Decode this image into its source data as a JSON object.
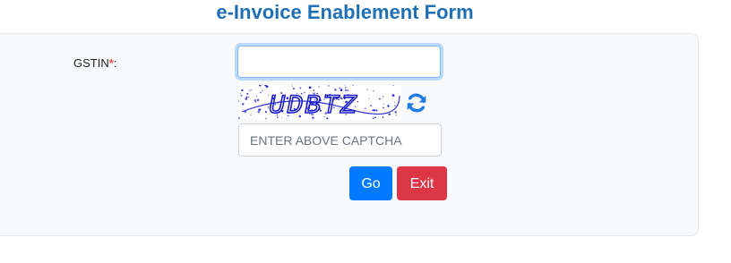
{
  "form": {
    "title": "e-Invoice Enablement Form",
    "gstin": {
      "label": "GSTIN",
      "required_marker": "*",
      "label_suffix": ":",
      "value": "",
      "placeholder": ""
    },
    "captcha": {
      "image_text": "UDBTZ",
      "input_value": "",
      "placeholder": "ENTER ABOVE CAPTCHA",
      "refresh_icon": "refresh-icon"
    },
    "buttons": {
      "go_label": "Go",
      "exit_label": "Exit"
    }
  },
  "colors": {
    "title": "#1f6fb5",
    "go_button": "#007bff",
    "exit_button": "#dc3545",
    "required_marker": "#d9534f",
    "captcha_text": "#1a1ac8",
    "refresh_icon": "#1e7be0"
  }
}
